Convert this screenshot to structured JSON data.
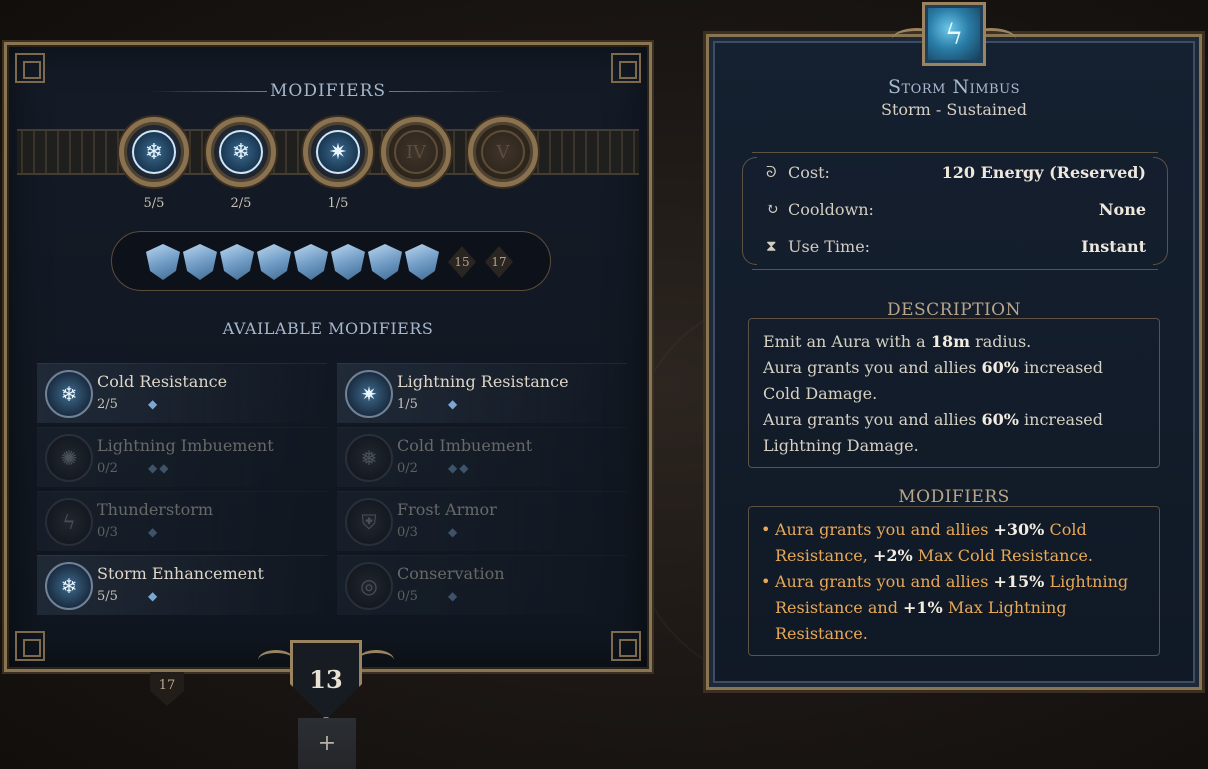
{
  "left": {
    "title": "MODIFIERS",
    "slots": [
      {
        "label": "",
        "count": "5/5",
        "icon": "storm-enhancement-icon"
      },
      {
        "label": "",
        "count": "2/5",
        "icon": "cold-resistance-icon"
      },
      {
        "label": "",
        "count": "1/5",
        "icon": "lightning-resistance-icon"
      },
      {
        "label": "IV",
        "count": ""
      },
      {
        "label": "V",
        "count": ""
      }
    ],
    "gems_filled": 8,
    "gem_labels": [
      "15",
      "17"
    ],
    "available_title": "AVAILABLE MODIFIERS",
    "modifiers": [
      {
        "name": "Cold Resistance",
        "count": "2/5",
        "pips": "◆"
      },
      {
        "name": "Lightning Resistance",
        "count": "1/5",
        "pips": "◆"
      },
      {
        "name": "Lightning Imbuement",
        "count": "0/2",
        "pips": "◆◆"
      },
      {
        "name": "Cold Imbuement",
        "count": "0/2",
        "pips": "◆◆"
      },
      {
        "name": "Thunderstorm",
        "count": "0/3",
        "pips": "◆"
      },
      {
        "name": "Frost Armor",
        "count": "0/3",
        "pips": "◆"
      },
      {
        "name": "Storm Enhancement",
        "count": "5/5",
        "pips": "◆"
      },
      {
        "name": "Conservation",
        "count": "0/5",
        "pips": "◆"
      }
    ],
    "level": "13",
    "small_level": "17",
    "plus": "+"
  },
  "right": {
    "skill_name": "Storm Nimbus",
    "skill_sub": "Storm - Sustained",
    "stats": [
      {
        "label": "Cost:",
        "value": "120 Energy (Reserved)",
        "icon": "energy-swirl-icon"
      },
      {
        "label": "Cooldown:",
        "value": "None",
        "icon": "cooldown-icon"
      },
      {
        "label": "Use Time:",
        "value": "Instant",
        "icon": "hourglass-icon"
      }
    ],
    "description_title": "DESCRIPTION",
    "description": {
      "l1a": "Emit an Aura with a ",
      "l1b": "18m",
      "l1c": " radius.",
      "l2a": "Aura grants you and allies ",
      "l2b": "60%",
      "l2c": " increased Cold Damage.",
      "l3a": "Aura grants you and allies ",
      "l3b": "60%",
      "l3c": " increased Lightning Damage."
    },
    "modifiers_title": "MODIFIERS",
    "modifiers": {
      "m1a": "Aura grants you and allies ",
      "m1b": "+30%",
      "m1c": " Cold Resistance, ",
      "m1d": "+2%",
      "m1e": " Max Cold Resistance.",
      "m2a": "Aura grants you and allies ",
      "m2b": "+15%",
      "m2c": " Lightning Resistance and ",
      "m2d": "+1%",
      "m2e": " Max Lightning Resistance."
    }
  },
  "colors": {
    "accent_gold": "#8a7553",
    "ice_blue": "#7ea7d0",
    "modifier_orange": "#e8a857"
  }
}
